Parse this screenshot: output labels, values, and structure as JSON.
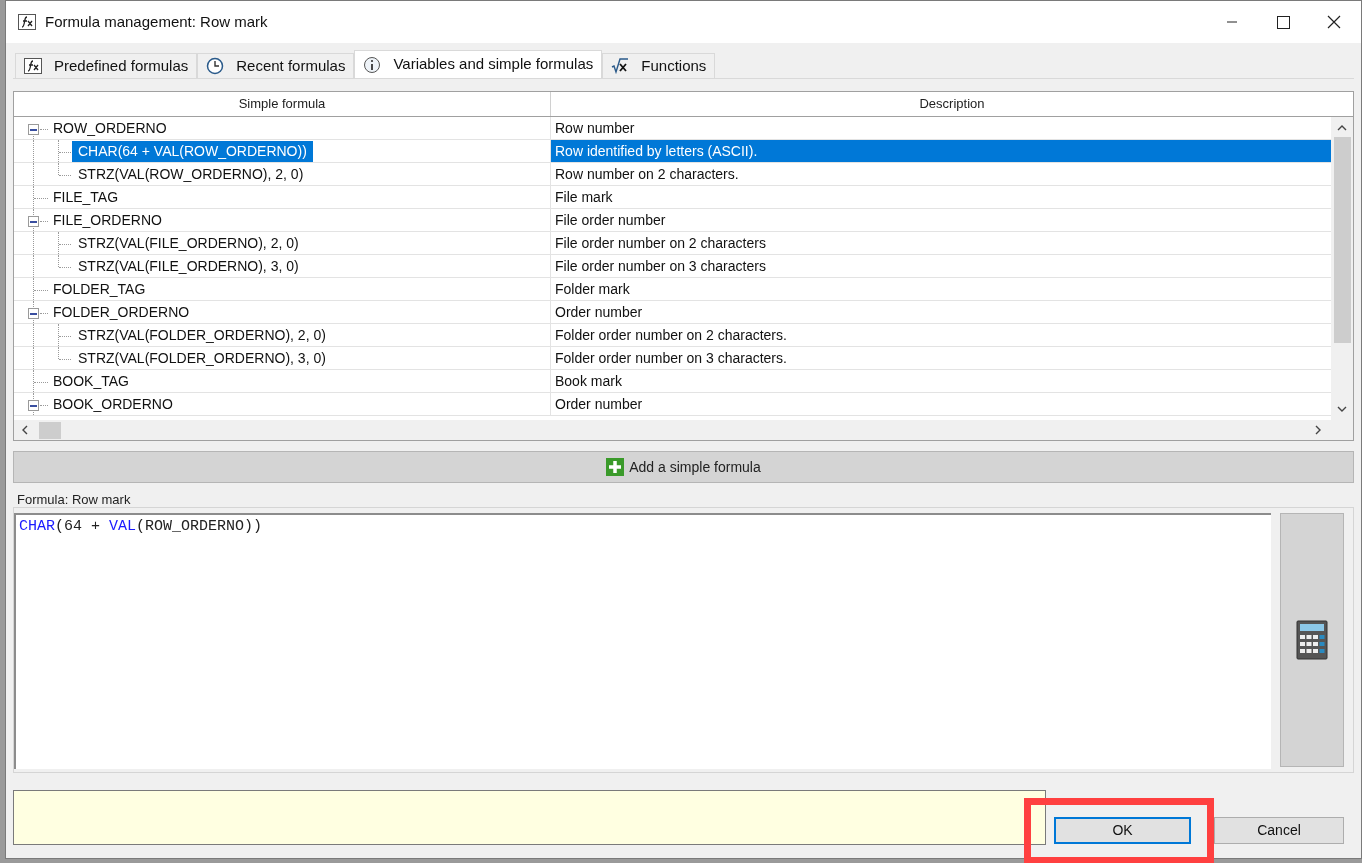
{
  "window": {
    "title": "Formula management: Row mark"
  },
  "tabs": [
    {
      "label": "Predefined formulas",
      "selected": false
    },
    {
      "label": "Recent formulas",
      "selected": false
    },
    {
      "label": "Variables and simple formulas",
      "selected": true
    },
    {
      "label": "Functions",
      "selected": false
    }
  ],
  "table": {
    "columns": [
      "Simple formula",
      "Description"
    ],
    "rows": [
      {
        "formula": "ROW_ORDERNO",
        "description": "Row number",
        "selected": false,
        "expanded": true,
        "children": [
          {
            "formula": "CHAR(64 + VAL(ROW_ORDERNO))",
            "description": "Row identified by letters (ASCII).",
            "selected": true
          },
          {
            "formula": "STRZ(VAL(ROW_ORDERNO), 2, 0)",
            "description": "Row number on 2 characters.",
            "selected": false
          }
        ]
      },
      {
        "formula": "FILE_TAG",
        "description": "File mark",
        "selected": false
      },
      {
        "formula": "FILE_ORDERNO",
        "description": "File order number",
        "selected": false,
        "expanded": true,
        "children": [
          {
            "formula": "STRZ(VAL(FILE_ORDERNO), 2, 0)",
            "description": "File order number on 2 characters",
            "selected": false
          },
          {
            "formula": "STRZ(VAL(FILE_ORDERNO), 3, 0)",
            "description": "File order number on 3 characters",
            "selected": false
          }
        ]
      },
      {
        "formula": "FOLDER_TAG",
        "description": "Folder mark",
        "selected": false
      },
      {
        "formula": "FOLDER_ORDERNO",
        "description": "Order number",
        "selected": false,
        "expanded": true,
        "children": [
          {
            "formula": "STRZ(VAL(FOLDER_ORDERNO), 2, 0)",
            "description": "Folder order number on 2 characters.",
            "selected": false
          },
          {
            "formula": "STRZ(VAL(FOLDER_ORDERNO), 3, 0)",
            "description": "Folder order number on 3 characters.",
            "selected": false
          }
        ]
      },
      {
        "formula": "BOOK_TAG",
        "description": "Book mark",
        "selected": false
      },
      {
        "formula": "BOOK_ORDERNO",
        "description": "Order number",
        "selected": false,
        "expanded": true
      }
    ]
  },
  "add_button": {
    "label": "Add a simple formula"
  },
  "formula": {
    "label": "Formula: Row mark",
    "tokens": [
      {
        "kind": "function",
        "text": "CHAR"
      },
      {
        "kind": "plain",
        "text": "(64 + "
      },
      {
        "kind": "function",
        "text": "VAL"
      },
      {
        "kind": "plain",
        "text": "(ROW_ORDERNO))"
      }
    ]
  },
  "buttons": [
    {
      "label": "OK",
      "default": true,
      "highlighted": true
    },
    {
      "label": "Cancel",
      "default": false,
      "highlighted": false
    }
  ]
}
